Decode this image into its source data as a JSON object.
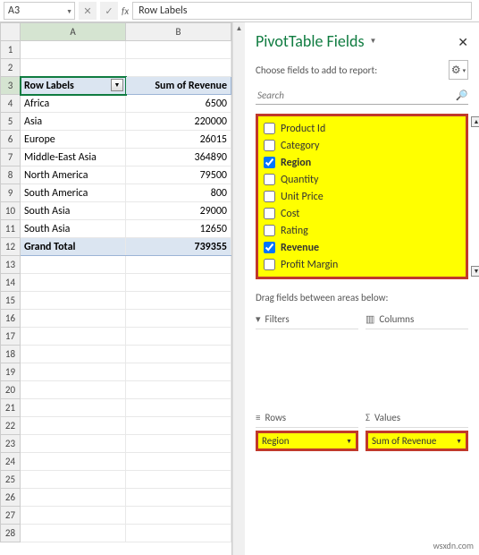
{
  "namebox": {
    "ref": "A3"
  },
  "formula_bar": {
    "value": "Row Labels"
  },
  "columns": [
    "A",
    "B"
  ],
  "rows_visible": 28,
  "active_cell": {
    "row": 3,
    "col": "A"
  },
  "pivot": {
    "row_header": "Row Labels",
    "value_header": "Sum of Revenue",
    "rows": [
      {
        "label": "Africa",
        "value": "6500"
      },
      {
        "label": "Asia",
        "value": "220000"
      },
      {
        "label": "Europe",
        "value": "26015"
      },
      {
        "label": "Middle-East Asia",
        "value": "364890"
      },
      {
        "label": "North America",
        "value": "79500"
      },
      {
        "label": "South America",
        "value": "800"
      },
      {
        "label": "South Asia",
        "value": "29000"
      },
      {
        "label": "South Asia",
        "value": "12650"
      }
    ],
    "grand_label": "Grand Total",
    "grand_value": "739355"
  },
  "pane": {
    "title": "PivotTable Fields",
    "subtitle": "Choose fields to add to report:",
    "search_placeholder": "Search",
    "fields": [
      {
        "name": "Product Id",
        "checked": false
      },
      {
        "name": "Category",
        "checked": false
      },
      {
        "name": "Region",
        "checked": true
      },
      {
        "name": "Quantity",
        "checked": false
      },
      {
        "name": "Unit Price",
        "checked": false
      },
      {
        "name": "Cost",
        "checked": false
      },
      {
        "name": "Rating",
        "checked": false
      },
      {
        "name": "Revenue",
        "checked": true
      },
      {
        "name": "Profit Margin",
        "checked": false
      }
    ],
    "between_label": "Drag fields between areas below:",
    "areas": {
      "filters": "Filters",
      "columns": "Columns",
      "rows": "Rows",
      "values": "Values",
      "sigma": "Σ"
    },
    "row_chip": "Region",
    "value_chip": "Sum of Revenue"
  },
  "watermark": "wsxdn.com"
}
